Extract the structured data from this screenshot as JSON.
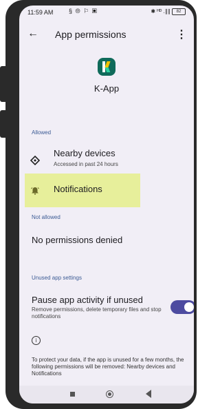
{
  "status_bar": {
    "time": "11:59 AM",
    "left_icons": "§ ⦾ ⚐ ▣",
    "right_icons": "✱ ᴴᴰ .∥∥",
    "battery": "82"
  },
  "header": {
    "back_icon": "arrow-back",
    "title": "App permissions",
    "menu_icon": "more-vert"
  },
  "app": {
    "name": "K-App",
    "icon": "k-app-logo"
  },
  "allowed": {
    "label": "Allowed",
    "items": [
      {
        "icon": "nearby-devices",
        "title": "Nearby devices",
        "subtitle": "Accessed in past 24 hours"
      },
      {
        "icon": "notifications-bell",
        "title": "Notifications"
      }
    ]
  },
  "not_allowed": {
    "label": "Not allowed",
    "empty_text": "No permissions denied"
  },
  "unused": {
    "label": "Unused app settings",
    "title": "Pause app activity if unused",
    "description": "Remove permissions, delete temporary files and stop notifications",
    "toggle_on": true
  },
  "info": {
    "icon": "info",
    "text": "To protect your data, if the app is unused for a few months, the following permissions will be removed: Nearby devices and Notifications"
  },
  "nav_bar": {
    "items": [
      "recents",
      "home",
      "back"
    ]
  },
  "colors": {
    "accent": "#4d4ba0",
    "highlight": "#e7ef9b",
    "section_label": "#3b5a94",
    "background": "#f1eef6"
  }
}
